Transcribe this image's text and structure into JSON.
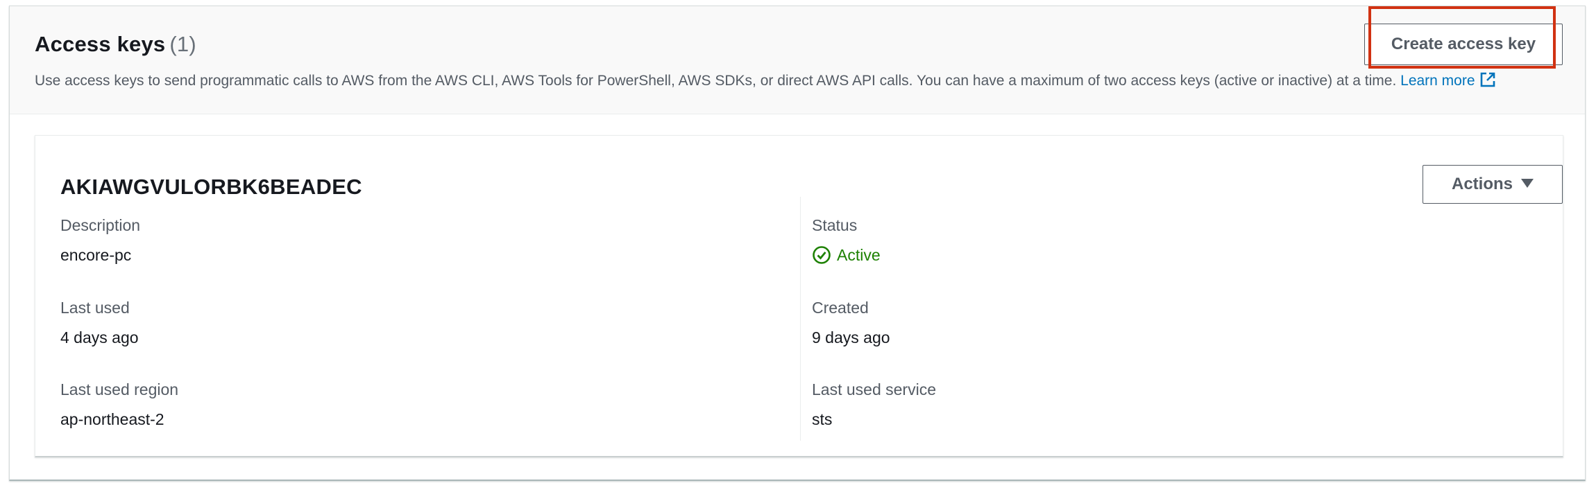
{
  "header": {
    "title": "Access keys",
    "count": "(1)",
    "description": "Use access keys to send programmatic calls to AWS from the AWS CLI, AWS Tools for PowerShell, AWS SDKs, or direct AWS API calls. You can have a maximum of two access keys (active or inactive) at a time.",
    "learn_more": "Learn more",
    "create_button": "Create access key"
  },
  "key": {
    "id": "AKIAWGVULORBK6BEADEC",
    "actions_label": "Actions",
    "fields": {
      "description_label": "Description",
      "description_value": "encore-pc",
      "status_label": "Status",
      "status_value": "Active",
      "last_used_label": "Last used",
      "last_used_value": "4 days ago",
      "created_label": "Created",
      "created_value": "9 days ago",
      "region_label": "Last used region",
      "region_value": "ap-northeast-2",
      "service_label": "Last used service",
      "service_value": "sts"
    }
  },
  "colors": {
    "accent_link": "#0073bb",
    "status_active": "#1d8102",
    "highlight": "#d13212"
  },
  "icons": {
    "external_link": "external-link-icon",
    "status": "check-circle-icon",
    "dropdown": "caret-down-icon"
  }
}
